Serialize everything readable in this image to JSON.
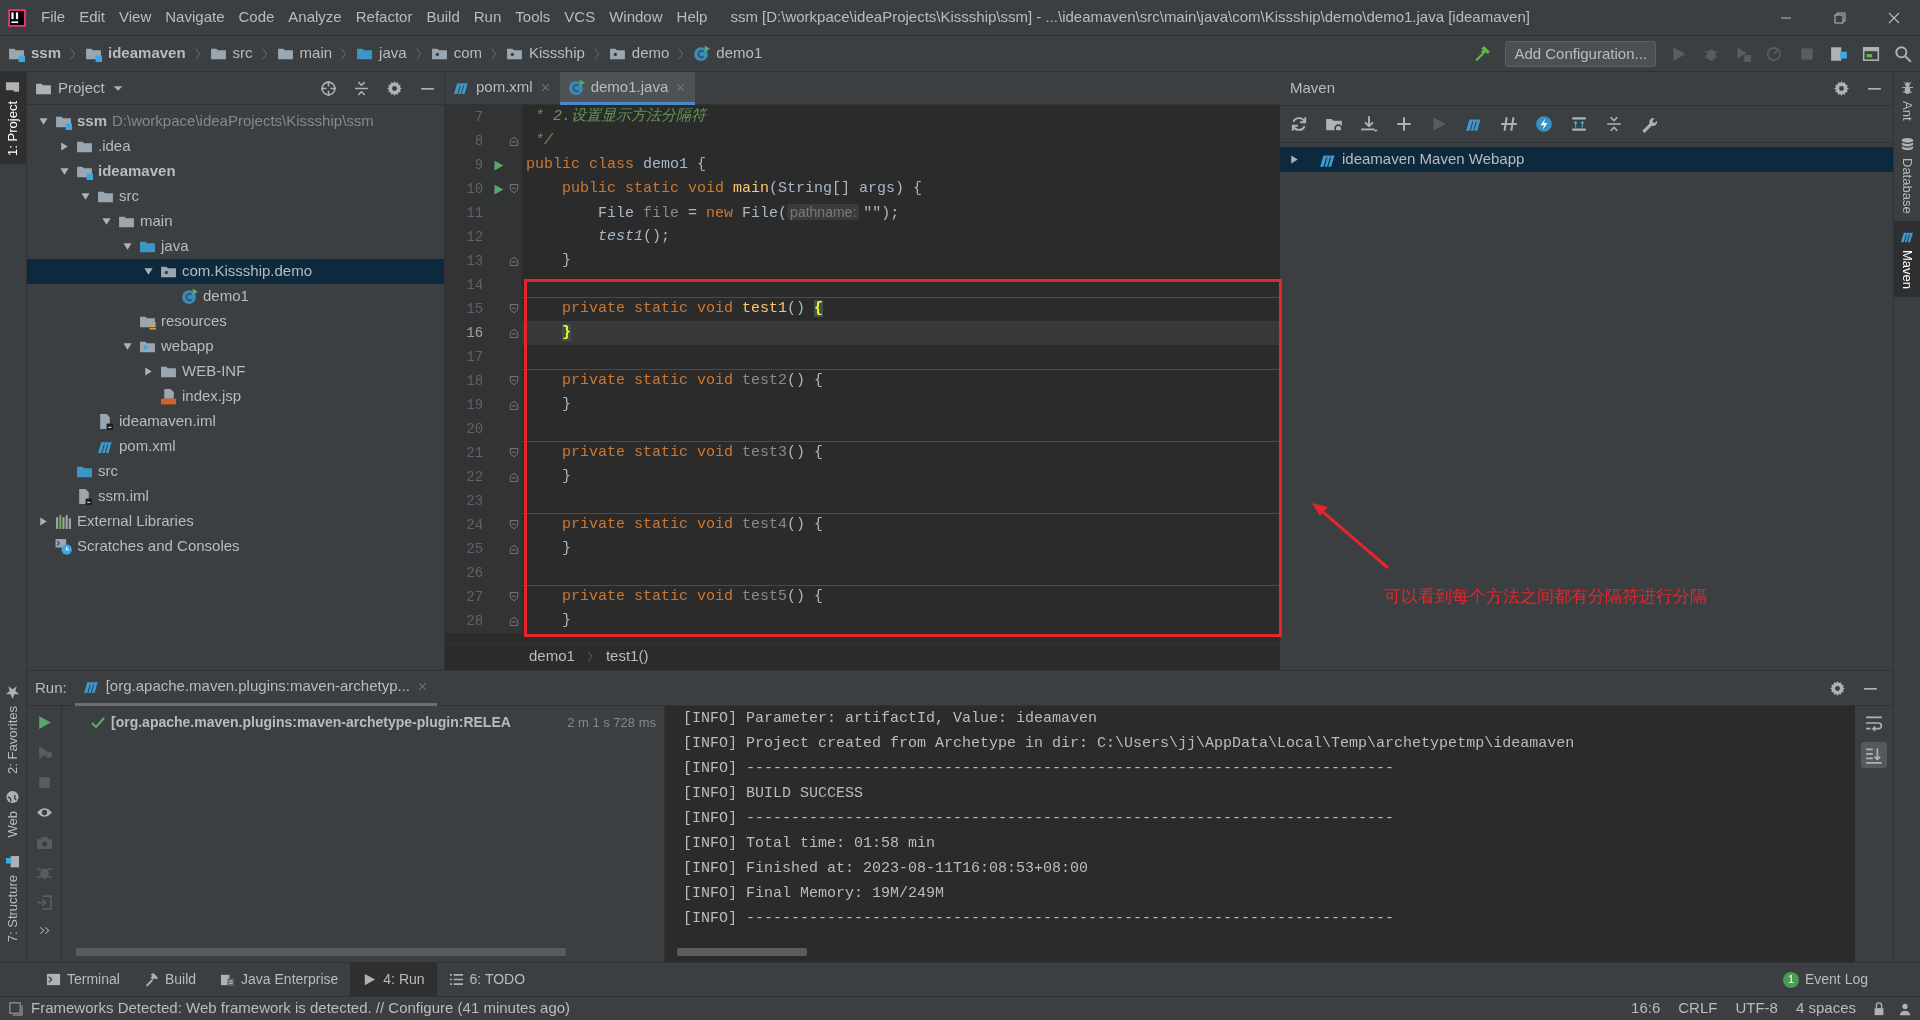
{
  "menubar": {
    "menus": [
      "File",
      "Edit",
      "View",
      "Navigate",
      "Code",
      "Analyze",
      "Refactor",
      "Build",
      "Run",
      "Tools",
      "VCS",
      "Window",
      "Help"
    ],
    "title": "ssm [D:\\workpace\\ideaProjects\\Kissship\\ssm] - ...\\ideamaven\\src\\main\\java\\com\\Kissship\\demo\\demo1.java [ideamaven]"
  },
  "navbar": {
    "crumbs": [
      {
        "label": "ssm",
        "kind": "module",
        "bold": true
      },
      {
        "label": "ideamaven",
        "kind": "module",
        "bold": true
      },
      {
        "label": "src",
        "kind": "folder",
        "bold": false
      },
      {
        "label": "main",
        "kind": "folder",
        "bold": false
      },
      {
        "label": "java",
        "kind": "source",
        "bold": false
      },
      {
        "label": "com",
        "kind": "package",
        "bold": false
      },
      {
        "label": "Kissship",
        "kind": "package",
        "bold": false
      },
      {
        "label": "demo",
        "kind": "package",
        "bold": false
      },
      {
        "label": "demo1",
        "kind": "class",
        "bold": false
      }
    ],
    "run_config": "Add Configuration..."
  },
  "tool_strips": {
    "left": [
      {
        "label": "1: Project",
        "kind": "project",
        "selected": true
      },
      {
        "label": "2: Favorites",
        "kind": "favorites",
        "selected": false
      },
      {
        "label": "Web",
        "kind": "web",
        "selected": false
      },
      {
        "label": "7: Structure",
        "kind": "structure",
        "selected": false
      }
    ],
    "right": [
      {
        "label": "Ant",
        "kind": "ant",
        "selected": false
      },
      {
        "label": "Database",
        "kind": "database",
        "selected": false
      },
      {
        "label": "Maven",
        "kind": "maven",
        "selected": true
      }
    ]
  },
  "project": {
    "title": "Project",
    "tree": [
      {
        "label": "ssm",
        "note": "D:\\workpace\\ideaProjects\\Kissship\\ssm",
        "kind": "module",
        "bold": true,
        "expanded": true,
        "selected": false,
        "children": [
          {
            "label": ".idea",
            "kind": "folder",
            "bold": false,
            "expanded": false,
            "selected": false
          },
          {
            "label": "ideamaven",
            "kind": "module",
            "bold": true,
            "expanded": true,
            "selected": false,
            "children": [
              {
                "label": "src",
                "kind": "folder",
                "bold": false,
                "expanded": true,
                "selected": false,
                "children": [
                  {
                    "label": "main",
                    "kind": "folder",
                    "bold": false,
                    "expanded": true,
                    "selected": false,
                    "children": [
                      {
                        "label": "java",
                        "kind": "source",
                        "bold": false,
                        "expanded": true,
                        "selected": false,
                        "children": [
                          {
                            "label": "com.Kissship.demo",
                            "kind": "package",
                            "bold": false,
                            "expanded": true,
                            "selected": true,
                            "children": [
                              {
                                "label": "demo1",
                                "kind": "class",
                                "bold": false,
                                "selected": false
                              }
                            ]
                          }
                        ]
                      },
                      {
                        "label": "resources",
                        "kind": "resources",
                        "bold": false,
                        "selected": false
                      },
                      {
                        "label": "webapp",
                        "kind": "web",
                        "bold": false,
                        "expanded": true,
                        "selected": false,
                        "children": [
                          {
                            "label": "WEB-INF",
                            "kind": "folder",
                            "bold": false,
                            "expanded": false,
                            "selected": false
                          },
                          {
                            "label": "index.jsp",
                            "kind": "jsp",
                            "bold": false,
                            "selected": false
                          }
                        ]
                      }
                    ]
                  }
                ]
              },
              {
                "label": "ideamaven.iml",
                "kind": "iml",
                "bold": false,
                "selected": false
              },
              {
                "label": "pom.xml",
                "kind": "maven",
                "bold": false,
                "selected": false
              }
            ]
          },
          {
            "label": "src",
            "kind": "source",
            "bold": false,
            "selected": false
          },
          {
            "label": "ssm.iml",
            "kind": "iml",
            "bold": false,
            "selected": false
          }
        ]
      },
      {
        "label": "External Libraries",
        "kind": "libraries",
        "bold": false,
        "expanded": false,
        "selected": false
      },
      {
        "label": "Scratches and Consoles",
        "kind": "scratches",
        "bold": false,
        "selected": false
      }
    ]
  },
  "editor": {
    "tabs": [
      {
        "label": "pom.xml",
        "kind": "maven",
        "selected": false
      },
      {
        "label": "demo1.java",
        "kind": "class",
        "selected": true
      }
    ],
    "lines": [
      {
        "number": "7",
        "run": false,
        "fold_start": false,
        "fold_end": false,
        "separator": false,
        "current": false,
        "tokens": [
          {
            "t": " * 2.设置显示方法分隔符",
            "kind": "comment"
          }
        ]
      },
      {
        "number": "8",
        "run": false,
        "fold_start": false,
        "fold_end": true,
        "separator": false,
        "current": false,
        "tokens": [
          {
            "t": " */",
            "kind": "comment"
          }
        ]
      },
      {
        "number": "9",
        "run": true,
        "fold_start": false,
        "fold_end": false,
        "separator": false,
        "current": false,
        "tokens": [
          {
            "t": "public class ",
            "kind": "kw"
          },
          {
            "t": "demo1 {",
            "kind": "plain"
          }
        ]
      },
      {
        "number": "10",
        "run": true,
        "fold_start": true,
        "fold_end": false,
        "separator": false,
        "current": false,
        "tokens": [
          {
            "t": "    public static void ",
            "kind": "kw"
          },
          {
            "t": "main",
            "kind": "decl"
          },
          {
            "t": "(String[] args) {",
            "kind": "plain"
          }
        ]
      },
      {
        "number": "11",
        "run": false,
        "fold_start": false,
        "fold_end": false,
        "separator": false,
        "current": false,
        "tokens": [
          {
            "t": "        File ",
            "kind": "plain"
          },
          {
            "t": "file",
            "kind": "unused"
          },
          {
            "t": " = ",
            "kind": "plain"
          },
          {
            "t": "new ",
            "kind": "kw"
          },
          {
            "t": "File(",
            "kind": "plain"
          },
          {
            "t": "pathname:",
            "kind": "hint"
          },
          {
            "t": "\"\"",
            "kind": "plain"
          },
          {
            "t": ");",
            "kind": "plain"
          }
        ]
      },
      {
        "number": "12",
        "run": false,
        "fold_start": false,
        "fold_end": false,
        "separator": false,
        "current": false,
        "tokens": [
          {
            "t": "        test1",
            "kind": "italic"
          },
          {
            "t": "();",
            "kind": "plain"
          }
        ]
      },
      {
        "number": "13",
        "run": false,
        "fold_start": false,
        "fold_end": true,
        "separator": false,
        "current": false,
        "tokens": [
          {
            "t": "    }",
            "kind": "plain"
          }
        ]
      },
      {
        "number": "14",
        "run": false,
        "fold_start": false,
        "fold_end": false,
        "separator": false,
        "current": false
      },
      {
        "number": "15",
        "run": false,
        "fold_start": true,
        "fold_end": false,
        "separator": true,
        "current": false,
        "tokens": [
          {
            "t": "    private static void ",
            "kind": "kw"
          },
          {
            "t": "test1",
            "kind": "decl"
          },
          {
            "t": "() ",
            "kind": "plain"
          },
          {
            "t": "{",
            "kind": "match"
          }
        ]
      },
      {
        "number": "16",
        "run": false,
        "fold_start": false,
        "fold_end": true,
        "separator": false,
        "current": true,
        "tokens": [
          {
            "t": "    }",
            "kind": "match"
          }
        ]
      },
      {
        "number": "17",
        "run": false,
        "fold_start": false,
        "fold_end": false,
        "separator": false,
        "current": false
      },
      {
        "number": "18",
        "run": false,
        "fold_start": true,
        "fold_end": false,
        "separator": true,
        "current": false,
        "tokens": [
          {
            "t": "    private static void ",
            "kind": "kw"
          },
          {
            "t": "test2",
            "kind": "unused"
          },
          {
            "t": "() {",
            "kind": "plain"
          }
        ]
      },
      {
        "number": "19",
        "run": false,
        "fold_start": false,
        "fold_end": true,
        "separator": false,
        "current": false,
        "tokens": [
          {
            "t": "    }",
            "kind": "plain"
          }
        ]
      },
      {
        "number": "20",
        "run": false,
        "fold_start": false,
        "fold_end": false,
        "separator": false,
        "current": false
      },
      {
        "number": "21",
        "run": false,
        "fold_start": true,
        "fold_end": false,
        "separator": true,
        "current": false,
        "tokens": [
          {
            "t": "    private static void ",
            "kind": "kw"
          },
          {
            "t": "test3",
            "kind": "unused"
          },
          {
            "t": "() {",
            "kind": "plain"
          }
        ]
      },
      {
        "number": "22",
        "run": false,
        "fold_start": false,
        "fold_end": true,
        "separator": false,
        "current": false,
        "tokens": [
          {
            "t": "    }",
            "kind": "plain"
          }
        ]
      },
      {
        "number": "23",
        "run": false,
        "fold_start": false,
        "fold_end": false,
        "separator": false,
        "current": false
      },
      {
        "number": "24",
        "run": false,
        "fold_start": true,
        "fold_end": false,
        "separator": true,
        "current": false,
        "tokens": [
          {
            "t": "    private static void ",
            "kind": "kw"
          },
          {
            "t": "test4",
            "kind": "unused"
          },
          {
            "t": "() {",
            "kind": "plain"
          }
        ]
      },
      {
        "number": "25",
        "run": false,
        "fold_start": false,
        "fold_end": true,
        "separator": false,
        "current": false,
        "tokens": [
          {
            "t": "    }",
            "kind": "plain"
          }
        ]
      },
      {
        "number": "26",
        "run": false,
        "fold_start": false,
        "fold_end": false,
        "separator": false,
        "current": false
      },
      {
        "number": "27",
        "run": false,
        "fold_start": true,
        "fold_end": false,
        "separator": true,
        "current": false,
        "tokens": [
          {
            "t": "    private static void ",
            "kind": "kw"
          },
          {
            "t": "test5",
            "kind": "unused"
          },
          {
            "t": "() {",
            "kind": "plain"
          }
        ]
      },
      {
        "number": "28",
        "run": false,
        "fold_start": false,
        "fold_end": true,
        "separator": false,
        "current": false,
        "tokens": [
          {
            "t": "    }",
            "kind": "plain"
          }
        ]
      }
    ],
    "breadcrumb": [
      "demo1",
      "test1()"
    ]
  },
  "maven": {
    "title": "Maven",
    "tree": [
      {
        "label": "ideamaven Maven Webapp",
        "expanded": false,
        "selected": true
      }
    ]
  },
  "run": {
    "label": "Run:",
    "tab": {
      "label": "[org.apache.maven.plugins:maven-archetyp...",
      "selected": true
    },
    "tree": [
      {
        "label": "[org.apache.maven.plugins:maven-archetype-plugin:RELEA",
        "time": "2 m 1 s 728 ms",
        "kind": "success"
      }
    ],
    "console": [
      "[INFO] Parameter: artifactId, Value: ideamaven",
      "[INFO] Project created from Archetype in dir: C:\\Users\\jj\\AppData\\Local\\Temp\\archetypetmp\\ideamaven",
      "[INFO] ------------------------------------------------------------------------",
      "[INFO] BUILD SUCCESS",
      "[INFO] ------------------------------------------------------------------------",
      "[INFO] Total time: 01:58 min",
      "[INFO] Finished at: 2023-08-11T16:08:53+08:00",
      "[INFO] Final Memory: 19M/249M",
      "[INFO] ------------------------------------------------------------------------"
    ]
  },
  "bottom_tabs": [
    {
      "label": "Terminal",
      "kind": "terminal",
      "selected": false
    },
    {
      "label": "Build",
      "kind": "build",
      "selected": false
    },
    {
      "label": "Java Enterprise",
      "kind": "enterprise",
      "selected": false
    },
    {
      "label": "4: Run",
      "kind": "run",
      "selected": true
    },
    {
      "label": "6: TODO",
      "kind": "todo",
      "selected": false
    }
  ],
  "event_log": {
    "label": "Event Log",
    "count": "1"
  },
  "status_bar": {
    "message": "Frameworks Detected: Web framework is detected. // Configure (41 minutes ago)",
    "items": [
      "16:6",
      "CRLF",
      "UTF-8",
      "4 spaces"
    ]
  },
  "annotation": {
    "text": "可以看到每个方法之间都有分隔符进行分隔"
  }
}
